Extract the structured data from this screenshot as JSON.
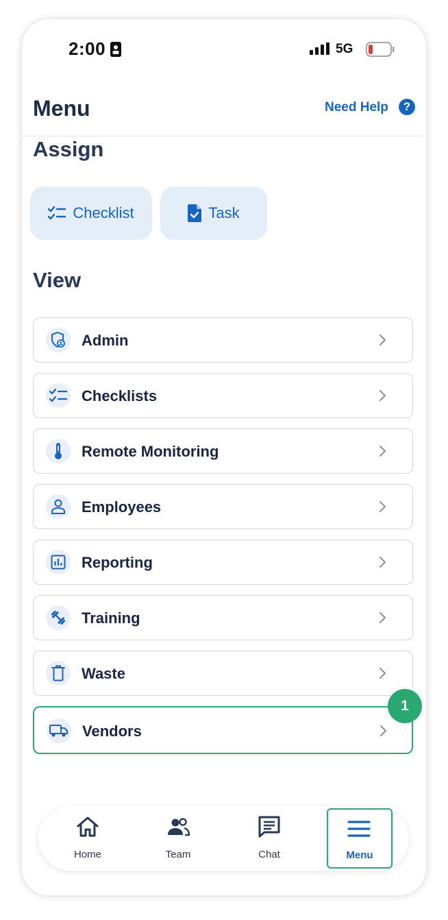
{
  "status_bar": {
    "time": "2:00",
    "network": "5G"
  },
  "header": {
    "title": "Menu",
    "help_label": "Need Help",
    "help_icon_glyph": "?"
  },
  "assign": {
    "title": "Assign",
    "buttons": [
      {
        "label": "Checklist",
        "icon": "checklist-icon"
      },
      {
        "label": "Task",
        "icon": "task-document-icon"
      }
    ]
  },
  "view": {
    "title": "View",
    "items": [
      {
        "label": "Admin",
        "icon": "admin-shield-icon"
      },
      {
        "label": "Checklists",
        "icon": "checklist-icon"
      },
      {
        "label": "Remote Monitoring",
        "icon": "thermometer-icon"
      },
      {
        "label": "Employees",
        "icon": "person-icon"
      },
      {
        "label": "Reporting",
        "icon": "bar-chart-icon"
      },
      {
        "label": "Training",
        "icon": "dumbbell-icon"
      },
      {
        "label": "Waste",
        "icon": "trash-icon"
      },
      {
        "label": "Vendors",
        "icon": "truck-icon",
        "highlighted": true
      }
    ]
  },
  "annotation_badge": "1",
  "tab_bar": {
    "tabs": [
      {
        "label": "Home",
        "icon": "home-icon"
      },
      {
        "label": "Team",
        "icon": "team-icon"
      },
      {
        "label": "Chat",
        "icon": "chat-icon"
      },
      {
        "label": "Menu",
        "icon": "hamburger-menu-icon",
        "active": true
      }
    ]
  },
  "colors": {
    "primary": "#1565c0",
    "heading": "#1e2a4a",
    "highlight": "#2aa872",
    "assign_button_bg": "#e3eef9",
    "icon_circle_bg": "#eaeef8"
  }
}
